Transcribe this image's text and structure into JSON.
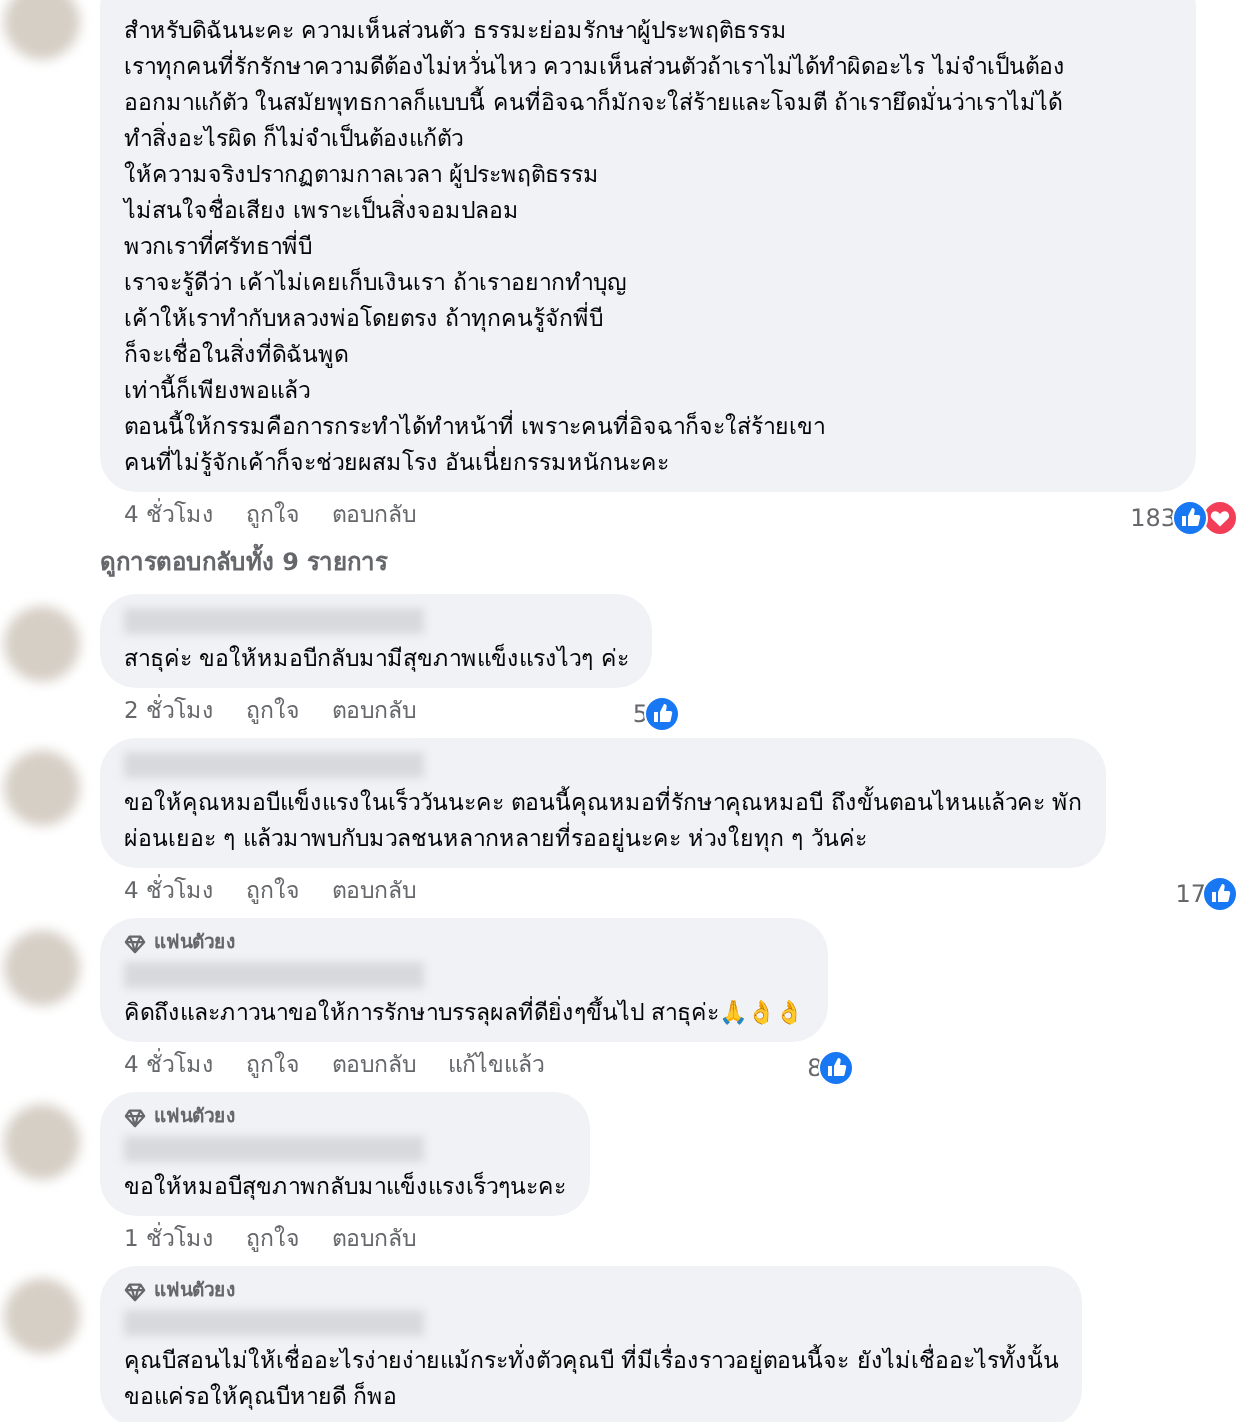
{
  "comments": [
    {
      "lines": [
        "สำหรับดิฉันนะคะ ความเห็นส่วนตัว ธรรมะย่อมรักษาผู้ประพฤติธรรม",
        "เราทุกคนที่รักรักษาความดีต้องไม่หวั่นไหว ความเห็นส่วนตัวถ้าเราไม่ได้ทำผิดอะไร ไม่จำเป็นต้อง",
        "ออกมาแก้ตัว ในสมัยพุทธกาลก็แบบนี้ คนที่อิจฉาก็มักจะใส่ร้ายและโจมตี ถ้าเรายึดมั่นว่าเราไม่ได้",
        "ทำสิ่งอะไรผิด ก็ไม่จำเป็นต้องแก้ตัว",
        "ให้ความจริงปรากฏตามกาลเวลา ผู้ประพฤติธรรม",
        "ไม่สนใจชื่อเสียง เพราะเป็นสิ่งจอมปลอม",
        "พวกเราที่ศรัทธาพี่บี",
        "เราจะรู้ดีว่า เค้าไม่เคยเก็บเงินเรา ถ้าเราอยากทำบุญ",
        "เค้าให้เราทำกับหลวงพ่อโดยตรง ถ้าทุกคนรู้จักพี่บี",
        "ก็จะเชื่อในสิ่งที่ดิฉันพูด",
        "เท่านี้ก็เพียงพอแล้ว",
        "ตอนนี้ให้กรรมคือการกระทำได้ทำหน้าที่ เพราะคนที่อิจฉาก็จะใส่ร้ายเขา",
        "คนที่ไม่รู้จักเค้าก็จะช่วยผสมโรง อันเนี่ยกรรมหนักนะคะ"
      ],
      "time": "4 ชั่วโมง",
      "like": "ถูกใจ",
      "reply": "ตอบกลับ",
      "reaction_count": "183",
      "reactions": [
        {
          "kind": "like"
        },
        {
          "kind": "love"
        }
      ],
      "view_replies": "ดูการตอบกลับทั้ง 9 รายการ"
    },
    {
      "name_blurred": true,
      "lines": [
        "สาธุค่ะ ขอให้หมอบีกลับมามีสุขภาพแข็งแรงไวๆ ค่ะ"
      ],
      "time": "2 ชั่วโมง",
      "like": "ถูกใจ",
      "reply": "ตอบกลับ",
      "reaction_count": "5",
      "reactions": [
        {
          "kind": "like"
        }
      ]
    },
    {
      "name_blurred": true,
      "lines": [
        "ขอให้คุณหมอบีแข็งแรงในเร็ววันนะคะ ตอนนี้คุณหมอที่รักษาคุณหมอบี ถึงขั้นตอนไหนแล้วคะ พัก",
        "ผ่อนเยอะ ๆ แล้วมาพบกับมวลชนหลากหลายที่รออยู่นะคะ ห่วงใยทุก ๆ วันค่ะ"
      ],
      "time": "4 ชั่วโมง",
      "like": "ถูกใจ",
      "reply": "ตอบกลับ",
      "reaction_count": "17",
      "reactions": [
        {
          "kind": "like"
        }
      ]
    },
    {
      "badge": "แฟนตัวยง",
      "name_blurred": true,
      "lines": [
        "คิดถึงและภาวนาขอให้การรักษาบรรลุผลที่ดียิ่งๆขึ้นไป สาธุค่ะ🙏👌👌"
      ],
      "time": "4 ชั่วโมง",
      "like": "ถูกใจ",
      "reply": "ตอบกลับ",
      "edited": "แก้ไขแล้ว",
      "reaction_count": "8",
      "reactions": [
        {
          "kind": "like"
        }
      ]
    },
    {
      "badge": "แฟนตัวยง",
      "name_blurred": true,
      "lines": [
        "ขอให้หมอบีสุขภาพกลับมาแข็งแรงเร็วๆนะคะ"
      ],
      "time": "1 ชั่วโมง",
      "like": "ถูกใจ",
      "reply": "ตอบกลับ"
    },
    {
      "badge": "แฟนตัวยง",
      "name_blurred": true,
      "lines": [
        "คุณบีสอนไม่ให้เชื่ออะไรง่ายง่ายแม้กระทั่งตัวคุณบี ที่มีเรื่องราวอยู่ตอนนี้จะ ยังไม่เชื่ออะไรทั้งนั้น",
        "ขอแค่รอให้คุณบีหายดี ก็พอ"
      ]
    }
  ]
}
